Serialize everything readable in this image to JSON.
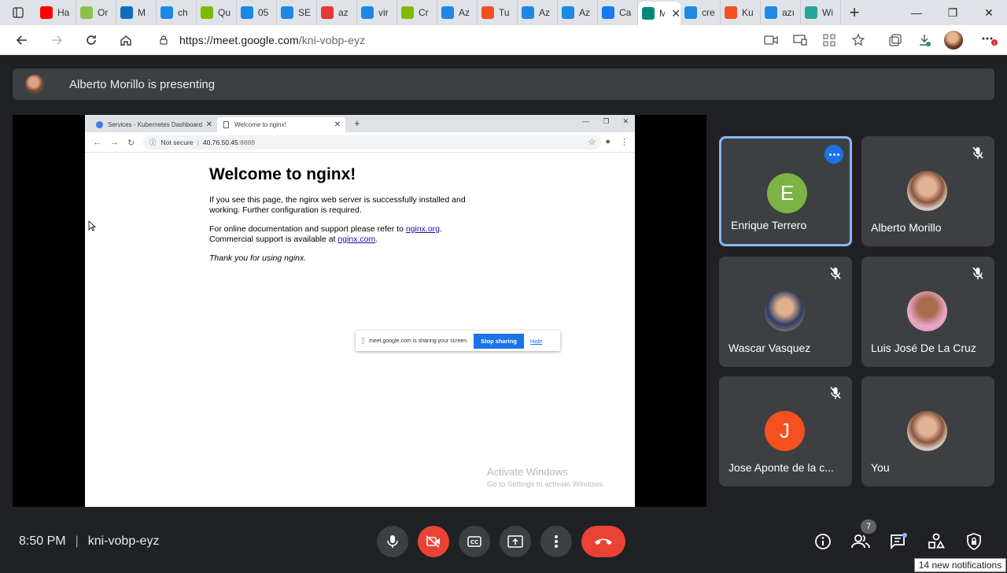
{
  "browser": {
    "tabs": [
      {
        "label": "Ha",
        "icon": "youtube-icon",
        "color": "#ff0000"
      },
      {
        "label": "Or",
        "icon": "leaf-icon",
        "color": "#8bc34a"
      },
      {
        "label": "M",
        "icon": "outlook-icon",
        "color": "#0f6cbd"
      },
      {
        "label": "ch",
        "icon": "bing-icon",
        "color": "#1e88e5"
      },
      {
        "label": "Qu",
        "icon": "microsoft-icon",
        "color": "#7fba00"
      },
      {
        "label": "05",
        "icon": "onedrive-icon",
        "color": "#1e88e5"
      },
      {
        "label": "SE",
        "icon": "bing-icon",
        "color": "#1e88e5"
      },
      {
        "label": "az",
        "icon": "pdf-icon",
        "color": "#e53935"
      },
      {
        "label": "vir",
        "icon": "bing-icon",
        "color": "#1e88e5"
      },
      {
        "label": "Cr",
        "icon": "microsoft-icon",
        "color": "#7fba00"
      },
      {
        "label": "Az",
        "icon": "bing-icon",
        "color": "#1e88e5"
      },
      {
        "label": "Tu",
        "icon": "microsoft-icon",
        "color": "#f25022"
      },
      {
        "label": "Az",
        "icon": "bing-icon",
        "color": "#1e88e5"
      },
      {
        "label": "Az",
        "icon": "bing-icon",
        "color": "#1e88e5"
      },
      {
        "label": "Ca",
        "icon": "facebook-icon",
        "color": "#1877f2"
      },
      {
        "label": "Me",
        "icon": "meet-icon",
        "color": "#00897b",
        "active": true
      },
      {
        "label": "cre",
        "icon": "bing-icon",
        "color": "#1e88e5"
      },
      {
        "label": "Ku",
        "icon": "microsoft-icon",
        "color": "#f25022"
      },
      {
        "label": "azı",
        "icon": "bing-icon",
        "color": "#1e88e5"
      },
      {
        "label": "Wi",
        "icon": "app-icon",
        "color": "#26a69a"
      }
    ],
    "url_host": "https://meet.google.com",
    "url_path": "/kni-vobp-eyz"
  },
  "meet": {
    "presenting_text": "Alberto Morillo is presenting",
    "meeting_code": "kni-vobp-eyz",
    "time": "8:50 PM",
    "participants_count": "7",
    "notifications": "14 new notifications",
    "participants": [
      {
        "name": "Enrique Terrero",
        "initial": "E",
        "color": "#7cb342",
        "active": true
      },
      {
        "name": "Alberto Morillo",
        "photo": true
      },
      {
        "name": "Wascar Vasquez",
        "photo": true
      },
      {
        "name": "Luis José De La Cruz",
        "photo": true
      },
      {
        "name": "Jose Aponte de la c...",
        "initial": "J",
        "color": "#f4511e"
      },
      {
        "name": "You",
        "photo": true
      }
    ]
  },
  "shared": {
    "tab1": "Services - Kubernetes Dashboard",
    "tab2": "Welcome to nginx!",
    "not_secure": "Not secure",
    "ip": "40.76.50.45",
    "port": ":8888",
    "heading": "Welcome to nginx!",
    "p1": "If you see this page, the nginx web server is successfully installed and working. Further configuration is required.",
    "p2_pre": "For online documentation and support please refer to ",
    "p2_link1": "nginx.org",
    "p2_mid": ".",
    "p2_line2": "Commercial support is available at ",
    "p2_link2": "nginx.com",
    "p2_end": ".",
    "p3": "Thank you for using nginx.",
    "share_text": "meet.google.com is sharing your screen.",
    "stop_sharing": "Stop sharing",
    "hide": "Hide",
    "activate1": "Activate Windows",
    "activate2": "Go to Settings to activate Windows."
  }
}
